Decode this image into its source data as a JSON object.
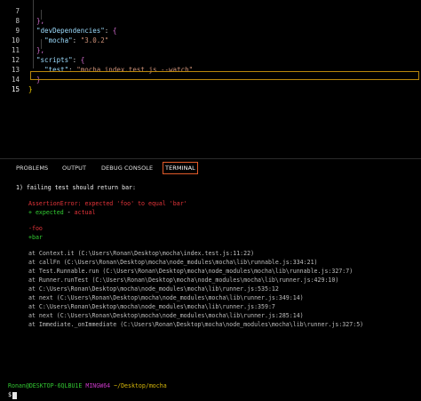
{
  "editor": {
    "lines": [
      {
        "number": "7",
        "text": "  },"
      },
      {
        "number": "8",
        "text": "  \"devDependencies\": {"
      },
      {
        "number": "9",
        "text": "    \"mocha\": \"3.0.2\""
      },
      {
        "number": "10",
        "text": "  },"
      },
      {
        "number": "11",
        "text": "  \"scripts\": {"
      },
      {
        "number": "12",
        "text": "    \"test\": \"mocha index.test.js --watch\""
      },
      {
        "number": "13",
        "text": "  }"
      },
      {
        "number": "14",
        "text": "}"
      },
      {
        "number": "15",
        "text": ""
      }
    ],
    "tokens": {
      "l7_a": "},",
      "l8_a": "\"devDependencies\"",
      "l8_b": ": ",
      "l8_c": "{",
      "l9_a": "\"mocha\"",
      "l9_b": ": ",
      "l9_c": "\"3.0.2\"",
      "l10_a": "},",
      "l11_a": "\"scripts\"",
      "l11_b": ": ",
      "l11_c": "{",
      "l12_a": "\"test\"",
      "l12_b": ": ",
      "l12_c": "\"mocha index.test.js --watch\"",
      "l13_a": "}",
      "l14_a": "}"
    },
    "active_line": "15"
  },
  "panel": {
    "tabs": [
      {
        "label": "PROBLEMS",
        "active": false
      },
      {
        "label": "OUTPUT",
        "active": false
      },
      {
        "label": "DEBUG CONSOLE",
        "active": false
      },
      {
        "label": "TERMINAL",
        "active": true
      }
    ],
    "active_border_color": "#e05a2a"
  },
  "terminal": {
    "failing_title": "1) failing test should return bar:",
    "assertion": "AssertionError: expected 'foo' to equal 'bar'",
    "diff_legend_expected": "+ expected",
    "diff_legend_sep": " - ",
    "diff_legend_actual": "actual",
    "diff_minus": "-foo",
    "diff_plus": "+bar",
    "stack": [
      "at Context.it (C:\\Users\\Ronan\\Desktop\\mocha\\index.test.js:11:22)",
      "at callFn (C:\\Users\\Ronan\\Desktop\\mocha\\node_modules\\mocha\\lib\\runnable.js:334:21)",
      "at Test.Runnable.run (C:\\Users\\Ronan\\Desktop\\mocha\\node_modules\\mocha\\lib\\runnable.js:327:7)",
      "at Runner.runTest (C:\\Users\\Ronan\\Desktop\\mocha\\node_modules\\mocha\\lib\\runner.js:429:10)",
      "at C:\\Users\\Ronan\\Desktop\\mocha\\node_modules\\mocha\\lib\\runner.js:535:12",
      "at next (C:\\Users\\Ronan\\Desktop\\mocha\\node_modules\\mocha\\lib\\runner.js:349:14)",
      "at C:\\Users\\Ronan\\Desktop\\mocha\\node_modules\\mocha\\lib\\runner.js:359:7",
      "at next (C:\\Users\\Ronan\\Desktop\\mocha\\node_modules\\mocha\\lib\\runner.js:285:14)",
      "at Immediate._onImmediate (C:\\Users\\Ronan\\Desktop\\mocha\\node_modules\\mocha\\lib\\runner.js:327:5)"
    ],
    "prompt_user": "Ronan@DESKTOP-6QLBU1E",
    "prompt_system": "MINGW64",
    "prompt_path": "~/Desktop/mocha",
    "prompt_symbol": "$"
  },
  "colors": {
    "background": "#000000",
    "error_red": "#e5343a",
    "diff_green": "#32cd32",
    "prompt_green": "#31c431",
    "prompt_magenta": "#c838c6",
    "prompt_yellow": "#d5b60a"
  }
}
